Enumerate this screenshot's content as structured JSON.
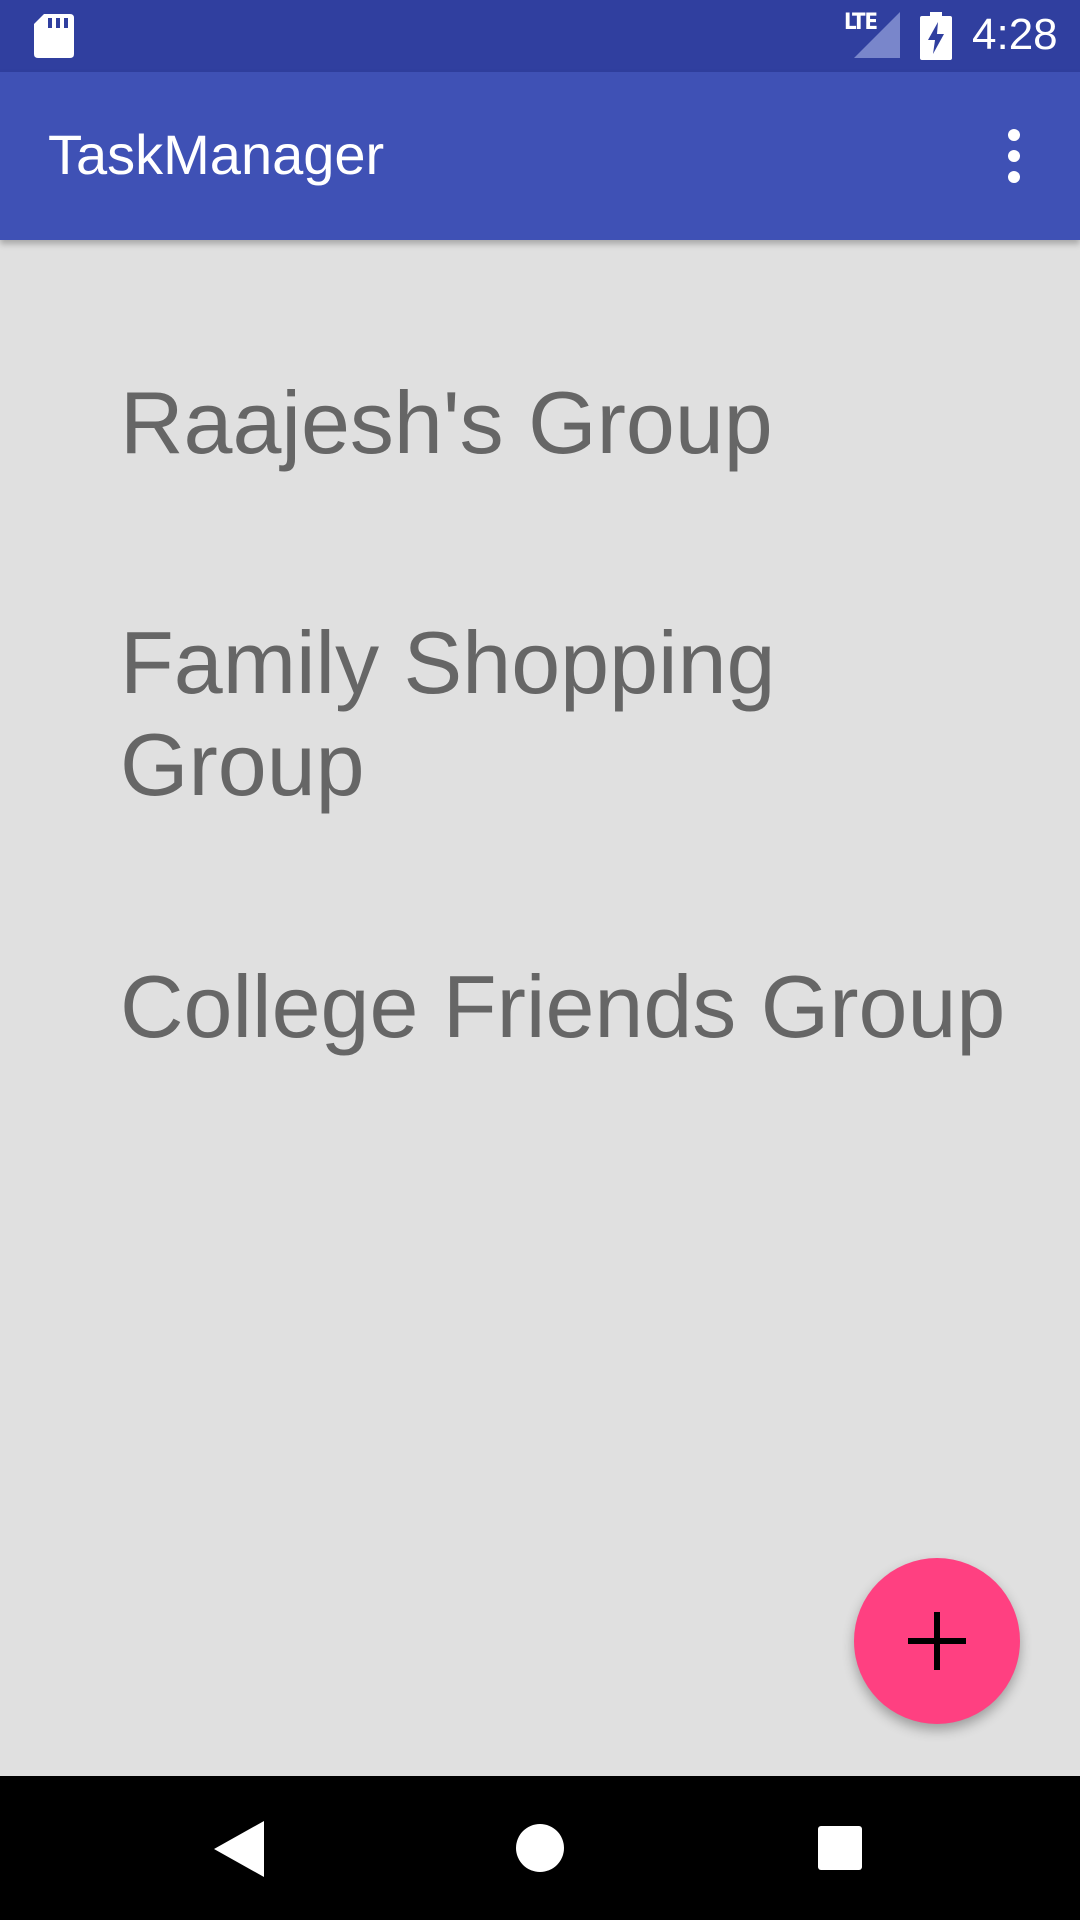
{
  "status_bar": {
    "network_label": "LTE",
    "time": "4:28",
    "icons": [
      "sd-card-icon",
      "lte-signal-icon",
      "battery-charging-icon"
    ]
  },
  "app_bar": {
    "title": "TaskManager",
    "overflow_icon": "more-vert-icon"
  },
  "groups": [
    {
      "name": "Raajesh's Group"
    },
    {
      "name": "Family Shopping Group"
    },
    {
      "name": "College Friends Group"
    }
  ],
  "fab": {
    "icon": "plus-icon",
    "color": "#ff4081"
  },
  "nav_bar": {
    "icons": [
      "back-icon",
      "home-icon",
      "recents-icon"
    ]
  },
  "colors": {
    "status_bar": "#303f9f",
    "app_bar": "#3f51b5",
    "background": "#e0e0e0",
    "list_text": "#666666",
    "accent": "#ff4081"
  }
}
